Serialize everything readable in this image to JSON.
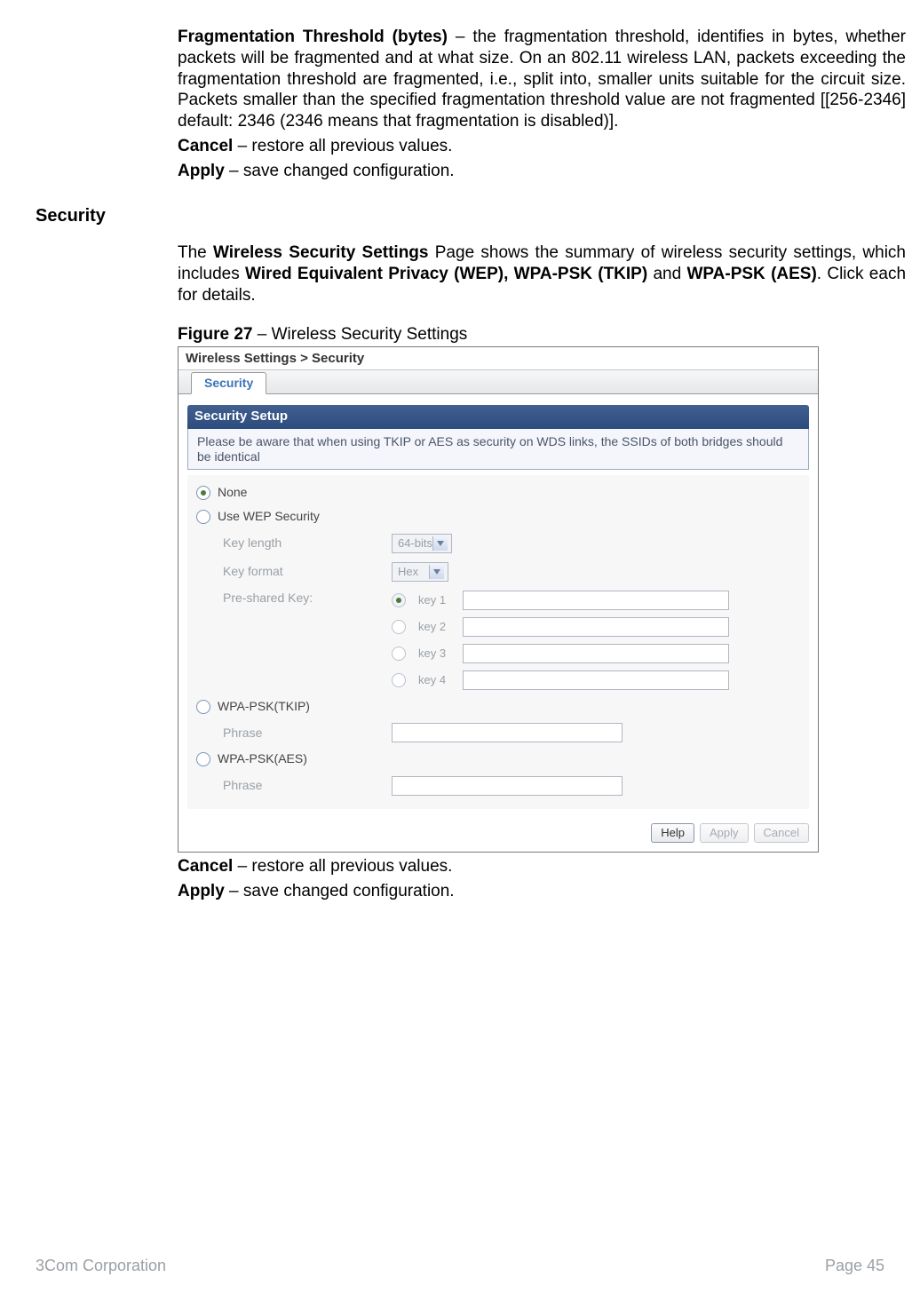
{
  "p1": {
    "term": "Fragmentation Threshold (bytes)",
    "text": " – the fragmentation threshold, identifies in bytes, whether packets will be fragmented and at what size. On an 802.11 wireless LAN, packets exceeding the fragmentation threshold are fragmented, i.e., split into, smaller units suitable for the circuit size. Packets smaller than the specified fragmentation threshold value are not fragmented [[256-2346] default: 2346 (2346 means that fragmentation is disabled)]."
  },
  "p2": {
    "term": "Cancel",
    "text": " – restore all previous values."
  },
  "p3": {
    "term": "Apply",
    "text": " – save changed configuration."
  },
  "section_heading": "Security",
  "intro": {
    "pre": "The ",
    "b1": "Wireless Security Settings",
    "mid": " Page shows the summary of wireless security settings, which includes ",
    "b2": "Wired Equivalent Privacy (WEP), WPA-PSK (TKIP)",
    "mid2": " and ",
    "b3": "WPA-PSK (AES)",
    "post": ". Click each for details."
  },
  "figure": {
    "label": "Figure 27",
    "title": " – Wireless Security Settings"
  },
  "sshot": {
    "breadcrumb": "Wireless Settings > Security",
    "tab": "Security",
    "panel_title": "Security Setup",
    "panel_note": "Please be aware that when using TKIP or AES as security on WDS links, the SSIDs  of both bridges  should be identical",
    "opts": {
      "none": "None",
      "wep": "Use WEP Security",
      "tkip": "WPA-PSK(TKIP)",
      "aes": "WPA-PSK(AES)"
    },
    "labels": {
      "keylen": "Key length",
      "keyfmt": "Key format",
      "psk": "Pre-shared Key:",
      "phrase": "Phrase"
    },
    "selects": {
      "keylen": "64-bits",
      "keyfmt": "Hex"
    },
    "keys": [
      "key 1",
      "key 2",
      "key 3",
      "key 4"
    ],
    "buttons": {
      "help": "Help",
      "apply": "Apply",
      "cancel": "Cancel"
    }
  },
  "p4": {
    "term": "Cancel",
    "text": " – restore all previous values."
  },
  "p5": {
    "term": "Apply",
    "text": " – save changed configuration."
  },
  "footer": {
    "left": "3Com Corporation",
    "right": "Page 45"
  }
}
